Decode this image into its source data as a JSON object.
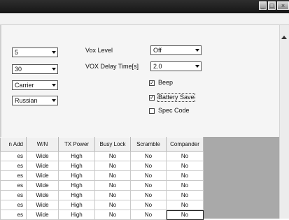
{
  "window": {
    "minimize_glyph": "_",
    "maximize_glyph": "□",
    "close_glyph": "×"
  },
  "form": {
    "left_selects": [
      {
        "value": "5"
      },
      {
        "value": "30"
      },
      {
        "value": "Carrier"
      },
      {
        "value": "Russian"
      }
    ],
    "vox_level": {
      "label": "Vox Level",
      "value": "Off"
    },
    "vox_delay": {
      "label": "VOX Delay Time[s]",
      "value": "2.0"
    },
    "beep": {
      "label": "Beep",
      "checked": true
    },
    "battery_save": {
      "label": "Battery Save",
      "checked": true
    },
    "spec_code": {
      "label": "Spec Code",
      "checked": false
    }
  },
  "grid": {
    "columns": [
      "n Add",
      "W/N",
      "TX Power",
      "Busy Lock",
      "Scramble",
      "Compander"
    ],
    "rows": [
      [
        "es",
        "Wide",
        "High",
        "No",
        "No",
        "No"
      ],
      [
        "es",
        "Wide",
        "High",
        "No",
        "No",
        "No"
      ],
      [
        "es",
        "Wide",
        "High",
        "No",
        "No",
        "No"
      ],
      [
        "es",
        "Wide",
        "High",
        "No",
        "No",
        "No"
      ],
      [
        "es",
        "Wide",
        "High",
        "No",
        "No",
        "No"
      ],
      [
        "es",
        "Wide",
        "High",
        "No",
        "No",
        "No"
      ],
      [
        "es",
        "Wide",
        "High",
        "No",
        "No",
        "No"
      ]
    ]
  }
}
